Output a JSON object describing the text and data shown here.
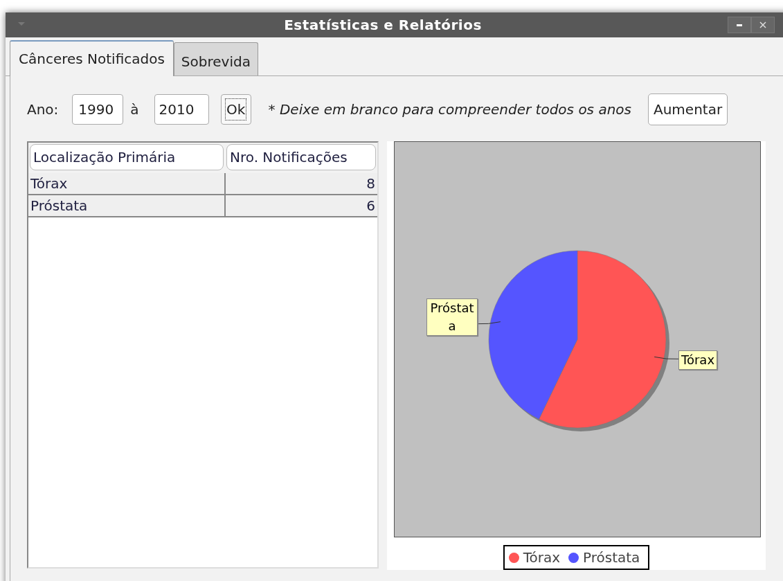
{
  "window": {
    "title": "Estatísticas e Relatórios"
  },
  "tabs": [
    {
      "label": "Cânceres Notificados",
      "selected": true
    },
    {
      "label": "Sobrevida",
      "selected": false
    }
  ],
  "filter": {
    "year_label": "Ano:",
    "from": "1990",
    "separator": "à",
    "to": "2010",
    "ok_button": "Ok",
    "hint": "* Deixe em branco para compreender todos os anos",
    "zoom_button": "Aumentar"
  },
  "table": {
    "columns": [
      "Localização Primária",
      "Nro. Notificações"
    ],
    "rows": [
      [
        "Tórax",
        "8"
      ],
      [
        "Próstata",
        "6"
      ]
    ]
  },
  "chart": {
    "legend": [
      {
        "label": "Tórax",
        "color": "#ff5555"
      },
      {
        "label": "Próstata",
        "color": "#5555ff"
      }
    ],
    "chart_data": {
      "type": "pie",
      "categories": [
        "Tórax",
        "Próstata"
      ],
      "values": [
        57.14,
        42.86
      ]
    }
  }
}
